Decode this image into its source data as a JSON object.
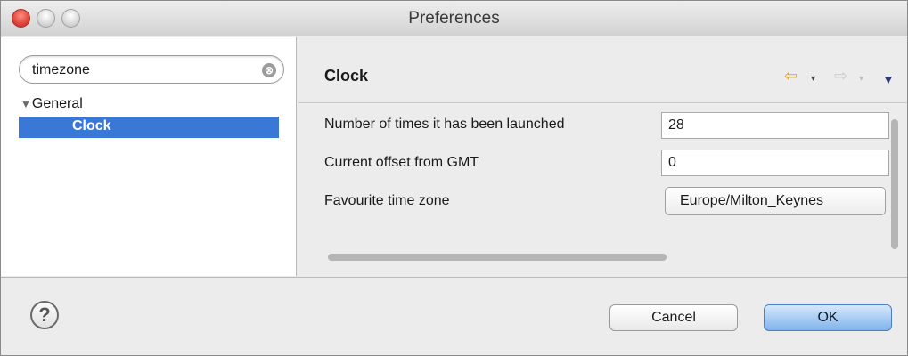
{
  "window": {
    "title": "Preferences"
  },
  "search": {
    "value": "timezone",
    "clear_icon": "⊗"
  },
  "tree": {
    "group_icon": "▼",
    "group_label": "General",
    "selected_item": "Clock"
  },
  "page": {
    "title": "Clock",
    "back_icon": "⇦",
    "forward_icon": "⇨",
    "dropdown_icon": "▾",
    "menu_icon": "▼"
  },
  "fields": {
    "launch_count_label": "Number of times it has been launched",
    "launch_count_value": "28",
    "gmt_offset_label": "Current offset from GMT",
    "gmt_offset_value": "0",
    "timezone_label": "Favourite time zone",
    "timezone_value": "Europe/Milton_Keynes"
  },
  "buttons": {
    "help_icon": "?",
    "cancel": "Cancel",
    "ok": "OK"
  },
  "colors": {
    "selection": "#3a78d8",
    "back_arrow": "#e4a81a",
    "ok_button": "#7fb3ec"
  }
}
